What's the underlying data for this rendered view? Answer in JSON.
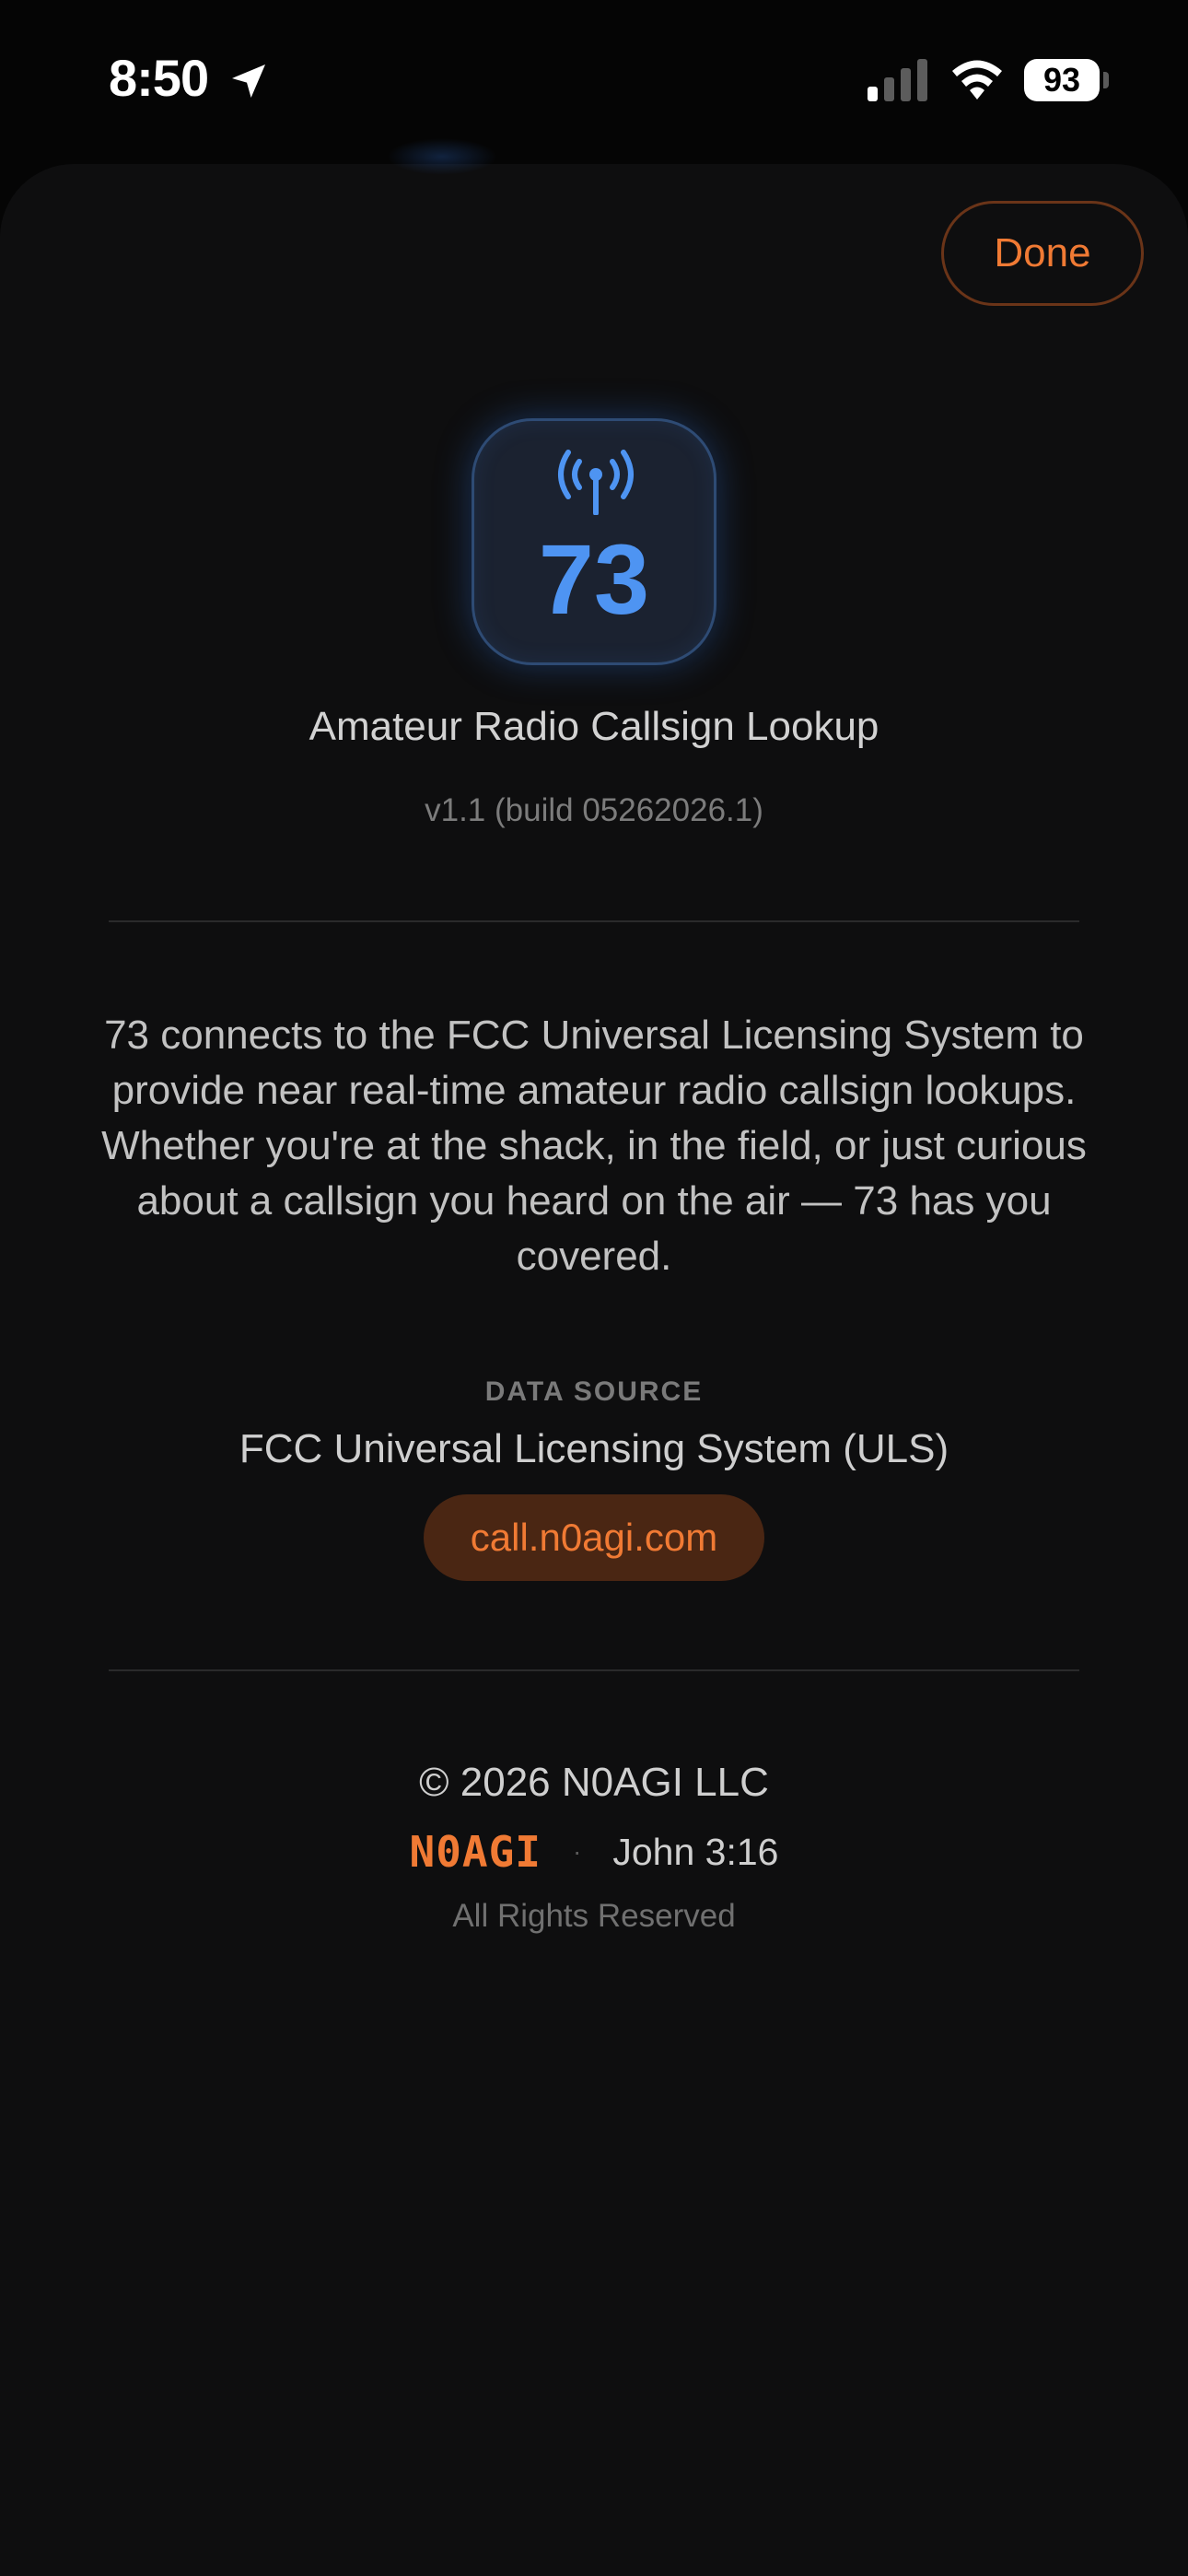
{
  "status_bar": {
    "time": "8:50",
    "battery": "93"
  },
  "header": {
    "done_label": "Done"
  },
  "app": {
    "icon_number": "73",
    "name": "Amateur Radio Callsign Lookup",
    "version": "v1.1 (build 05262026.1)"
  },
  "about": {
    "description": "73 connects to the FCC Universal Licensing System to provide near real-time amateur radio callsign lookups. Whether you're at the shack, in the field, or just curious about a callsign you heard on the air — 73 has you covered."
  },
  "data_source": {
    "label": "DATA SOURCE",
    "value": "FCC Universal Licensing System (ULS)",
    "link": "call.n0agi.com"
  },
  "footer": {
    "copyright": "© 2026 N0AGI LLC",
    "brand": "N0AGI",
    "separator": "·",
    "verse": "John 3:16",
    "rights": "All Rights Reserved"
  },
  "colors": {
    "accent": "#f07a34",
    "icon_blue": "#4e94f2",
    "background": "#0e0e0f"
  },
  "icons": [
    "location-arrow-icon",
    "cellular-signal-icon",
    "wifi-icon",
    "battery-icon",
    "antenna-icon"
  ]
}
